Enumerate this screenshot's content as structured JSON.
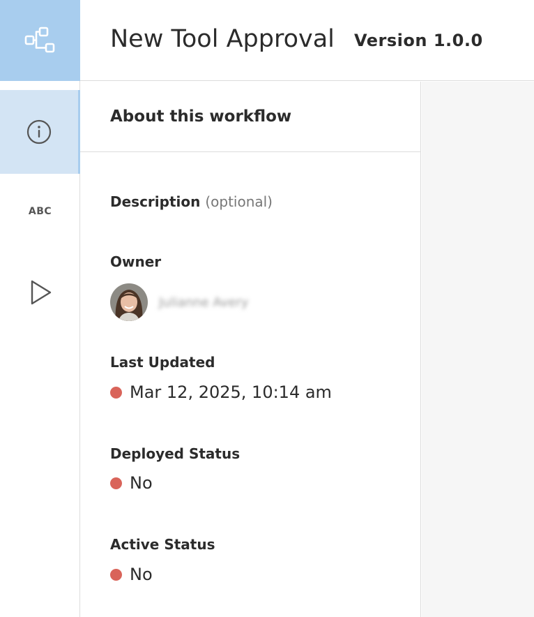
{
  "app": {
    "title": "New Tool Approval",
    "version": "Version 1.0.0",
    "accent_color": "#a8cdee",
    "active_bg_color": "#d3e4f4"
  },
  "sidebar": {
    "logo_icon": "workflow-icon",
    "items": [
      {
        "icon": "info-icon",
        "active": true
      },
      {
        "icon": "abc-icon",
        "text": "ABC",
        "active": false
      },
      {
        "icon": "play-icon",
        "active": false
      }
    ]
  },
  "panel": {
    "title": "About this workflow",
    "description": {
      "label": "Description",
      "hint": "(optional)"
    },
    "owner": {
      "label": "Owner",
      "name": "Julianne Avery"
    },
    "last_updated": {
      "label": "Last Updated",
      "value": "Mar 12, 2025, 10:14 am",
      "status_color": "#d9645a"
    },
    "deployed": {
      "label": "Deployed Status",
      "value": "No",
      "status_color": "#d9645a"
    },
    "active": {
      "label": "Active Status",
      "value": "No",
      "status_color": "#d9645a"
    }
  }
}
